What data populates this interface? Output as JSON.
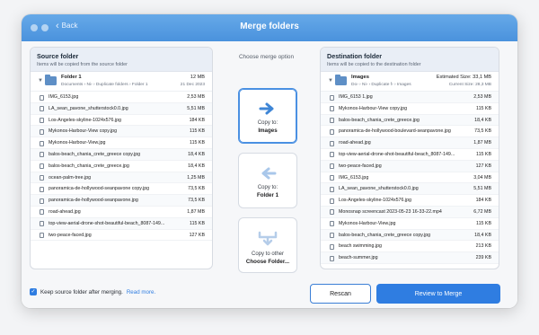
{
  "window": {
    "title": "Merge folders",
    "back_label": "Back"
  },
  "source": {
    "title": "Source folder",
    "subtitle": "Items will be copied from the source folder",
    "folder": {
      "name": "Folder 1",
      "path": "Documents › Ni› › Duplicate folders › Folder 1",
      "size": "12 MB",
      "date": "21 Dec 2023"
    },
    "files": [
      {
        "name": "IMG_6153.jpg",
        "size": "2,53 MB"
      },
      {
        "name": "LA_sean_pavone_shutterstock0.0.jpg",
        "size": "5,51 MB"
      },
      {
        "name": "Los-Angeles-skyline-1024x576.jpg",
        "size": "184 KB"
      },
      {
        "name": "Mykonos-Harbour-View copy.jpg",
        "size": "115 KB"
      },
      {
        "name": "Mykonos-Harbour-View.jpg",
        "size": "115 KB"
      },
      {
        "name": "balos-beach_chania_crete_greece copy.jpg",
        "size": "18,4 KB"
      },
      {
        "name": "balos-beach_chania_crete_greece.jpg",
        "size": "18,4 KB"
      },
      {
        "name": "ocean-palm-tree.jpg",
        "size": "1,25 MB"
      },
      {
        "name": "panoramica-de-hollywood-seanpavone copy.jpg",
        "size": "73,5 KB"
      },
      {
        "name": "panoramica-de-hollywood-seanpavone.jpg",
        "size": "73,5 KB"
      },
      {
        "name": "road-ahead.jpg",
        "size": "1,87 MB"
      },
      {
        "name": "top-view-aerial-drone-shot-beautiful-beach_8087-149...",
        "size": "115 KB"
      },
      {
        "name": "two-peace-faced.jpg",
        "size": "127 KB"
      }
    ]
  },
  "middle": {
    "title": "Choose merge option",
    "options": [
      {
        "line1": "Copy to:",
        "line2": "Images",
        "icon": "arrow-right-icon"
      },
      {
        "line1": "Copy to:",
        "line2": "Folder 1",
        "icon": "arrow-left-icon"
      },
      {
        "line1": "Copy to other",
        "line2": "Choose Folder...",
        "icon": "merge-arrow-icon"
      }
    ]
  },
  "destination": {
    "title": "Destination folder",
    "subtitle": "Items will be copied to the destination folder",
    "folder": {
      "name": "Images",
      "path": "Do› › Ni› › Duplicate f› › Images",
      "size": "Estimated Size: 33,1 MB",
      "current": "Current Size: 28,3 MB"
    },
    "files": [
      {
        "name": "IMG_6153 1.jpg",
        "size": "2,53 MB"
      },
      {
        "name": "Mykonos-Harbour-View copy.jpg",
        "size": "115 KB"
      },
      {
        "name": "balos-beach_chania_crete_greece.jpg",
        "size": "18,4 KB"
      },
      {
        "name": "panoramica-de-hollywood-boulevard-seanpavone.jpg",
        "size": "73,5 KB"
      },
      {
        "name": "road-ahead.jpg",
        "size": "1,87 MB"
      },
      {
        "name": "top-view-aerial-drone-shot-beautiful-beach_8087-149...",
        "size": "115 KB"
      },
      {
        "name": "two-peace-faced.jpg",
        "size": "127 KB"
      },
      {
        "name": "IMG_6153.jpg",
        "size": "3,04 MB"
      },
      {
        "name": "LA_sean_pavone_shutterstock0.0.jpg",
        "size": "5,51 MB"
      },
      {
        "name": "Los-Angeles-skyline-1024x576.jpg",
        "size": "184 KB"
      },
      {
        "name": "Monosnap screencast 2023-05-23 16-33-22.mp4",
        "size": "6,72 MB"
      },
      {
        "name": "Mykonos-Harbour-View.jpg",
        "size": "115 KB"
      },
      {
        "name": "balos-beach_chania_crete_greece copy.jpg",
        "size": "18,4 KB"
      },
      {
        "name": "beach swimming.jpg",
        "size": "213 KB"
      },
      {
        "name": "beach-summer.jpg",
        "size": "239 KB"
      }
    ]
  },
  "footer": {
    "checkbox_label": "Keep source folder after merging.",
    "read_more": "Read more.",
    "rescan": "Rescan",
    "review": "Review to Merge"
  }
}
